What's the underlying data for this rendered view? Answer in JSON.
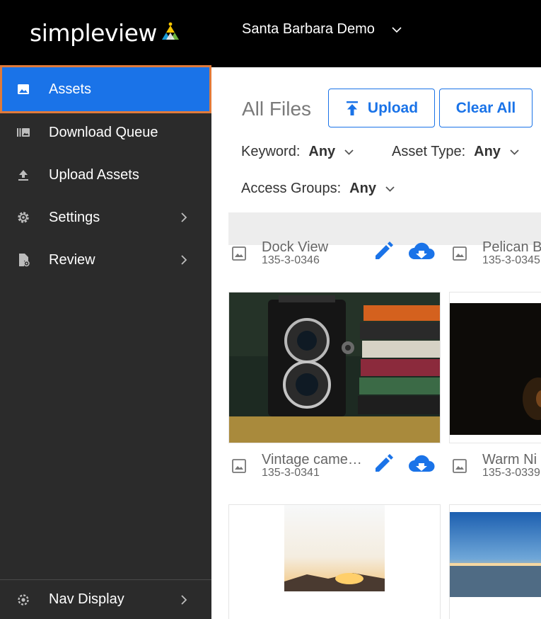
{
  "brand": {
    "name": "simpleview",
    "colors": {
      "accent": "#1a73e8",
      "highlight": "#e07a3a",
      "sidebar": "#2b2b2b",
      "header": "#000000"
    }
  },
  "header": {
    "org_name": "Santa Barbara Demo",
    "org_chevron": "chevron-down-icon"
  },
  "sidebar": {
    "items": [
      {
        "label": "Assets",
        "icon": "image-icon",
        "active": true
      },
      {
        "label": "Download Queue",
        "icon": "queue-icon"
      },
      {
        "label": "Upload Assets",
        "icon": "upload-icon"
      },
      {
        "label": "Settings",
        "icon": "gear-icon",
        "has_submenu": true
      },
      {
        "label": "Review",
        "icon": "file-review-icon",
        "has_submenu": true
      }
    ],
    "bottom": {
      "label": "Nav Display",
      "icon": "gear-icon",
      "has_submenu": true
    }
  },
  "main": {
    "title": "All Files",
    "buttons": {
      "upload": "Upload",
      "clear_all": "Clear All"
    },
    "filters": {
      "keyword": {
        "label": "Keyword:",
        "value": "Any"
      },
      "asset_type": {
        "label": "Asset Type:",
        "value": "Any"
      },
      "access_groups": {
        "label": "Access Groups:",
        "value": "Any"
      }
    },
    "assets": [
      {
        "title": "Dock View",
        "id": "135-3-0346"
      },
      {
        "title": "Pelican B",
        "id": "135-3-0345"
      },
      {
        "title": "Vintage came…",
        "id": "135-3-0341"
      },
      {
        "title": "Warm Ni",
        "id": "135-3-0339"
      }
    ]
  }
}
